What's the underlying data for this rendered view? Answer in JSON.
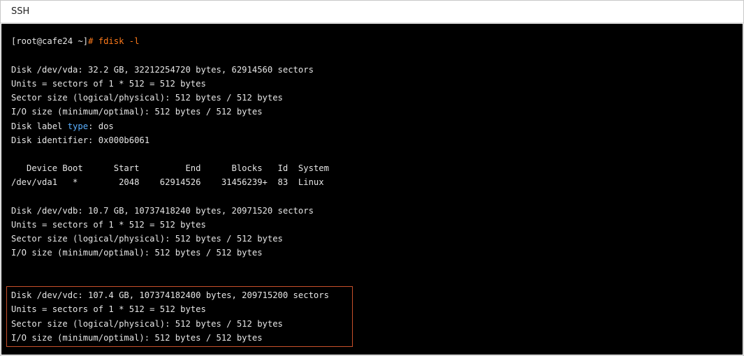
{
  "window": {
    "title": "SSH"
  },
  "terminal": {
    "prompt": "[root@cafe24 ~]",
    "command": "# fdisk -l",
    "disk_vda": {
      "header": "Disk /dev/vda: 32.2 GB, 32212254720 bytes, 62914560 sectors",
      "units": "Units = sectors of 1 * 512 = 512 bytes",
      "sector_size": "Sector size (logical/physical): 512 bytes / 512 bytes",
      "io_size": "I/O size (minimum/optimal): 512 bytes / 512 bytes",
      "label_prefix": "Disk label ",
      "label_keyword": "type",
      "label_suffix": ": dos",
      "identifier": "Disk identifier: 0x000b6061"
    },
    "partition_table": {
      "header": "   Device Boot      Start         End      Blocks   Id  System",
      "rows": [
        "/dev/vda1   *        2048    62914526    31456239+  83  Linux"
      ]
    },
    "disk_vdb": {
      "header": "Disk /dev/vdb: 10.7 GB, 10737418240 bytes, 20971520 sectors",
      "units": "Units = sectors of 1 * 512 = 512 bytes",
      "sector_size": "Sector size (logical/physical): 512 bytes / 512 bytes",
      "io_size": "I/O size (minimum/optimal): 512 bytes / 512 bytes"
    },
    "disk_vdc": {
      "header": "Disk /dev/vdc: 107.4 GB, 107374182400 bytes, 209715200 sectors",
      "units": "Units = sectors of 1 * 512 = 512 bytes",
      "sector_size": "Sector size (logical/physical): 512 bytes / 512 bytes",
      "io_size": "I/O size (minimum/optimal): 512 bytes / 512 bytes"
    }
  },
  "colors": {
    "terminal_bg": "#000000",
    "terminal_text": "#e6e6e6",
    "command": "#ff7a1a",
    "keyword": "#5ab0ff",
    "highlight_border": "#c8502a"
  }
}
